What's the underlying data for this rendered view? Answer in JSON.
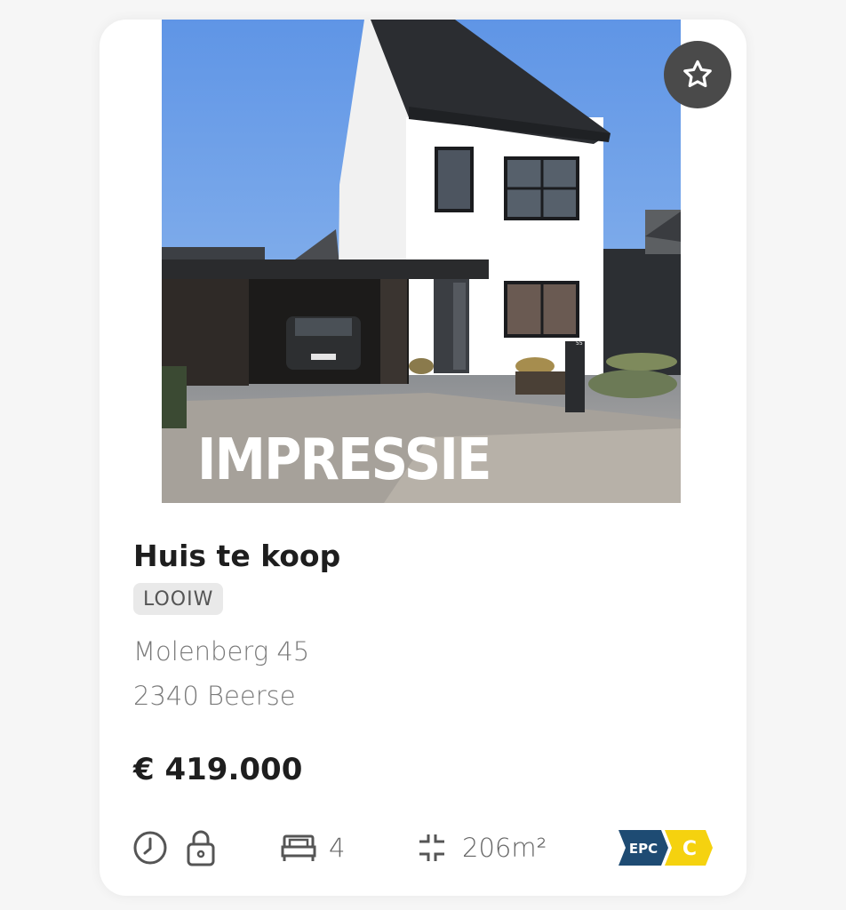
{
  "listing": {
    "photo_overlay": "IMPRESSIE",
    "title": "Huis te koop",
    "badge": "LOOIW",
    "address_line1": "Molenberg 45",
    "address_line2": "2340 Beerse",
    "price": "€ 419.000",
    "bedrooms": "4",
    "area": "206m²",
    "epc_label": "EPC",
    "epc_grade": "C",
    "house_number_sign": "55"
  },
  "icons": {
    "favorite": "star-outline-icon",
    "recent": "clock-icon",
    "locked": "lock-icon",
    "bedrooms": "bed-icon",
    "area": "area-compress-icon"
  },
  "colors": {
    "epc_dark": "#1e4b73",
    "epc_grade": "#f5d20f",
    "fav_button": "#4a4a4a",
    "title_text": "#1e1e1e",
    "address_text": "#7a7a7a"
  }
}
